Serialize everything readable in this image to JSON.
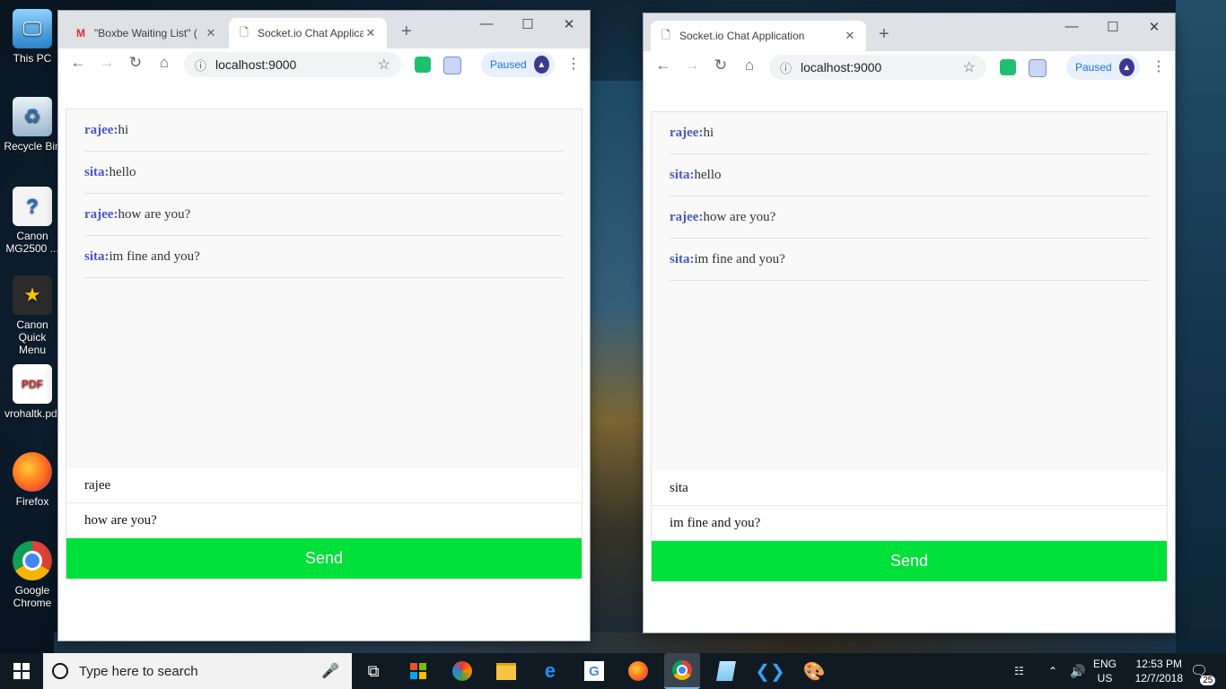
{
  "desktop": {
    "icons": [
      {
        "label_line1": "This PC",
        "label_line2": "",
        "icon": "computer-icon"
      },
      {
        "label_line1": "Recycle Bin",
        "label_line2": "",
        "icon": "recycle-bin-icon"
      },
      {
        "label_line1": "Canon",
        "label_line2": "MG2500 ...",
        "icon": "help-document-icon"
      },
      {
        "label_line1": "Canon Quick",
        "label_line2": "Menu",
        "icon": "canon-menu-icon"
      },
      {
        "label_line1": "vrohaltk.pdf",
        "label_line2": "",
        "icon": "pdf-icon"
      },
      {
        "label_line1": "Firefox",
        "label_line2": "",
        "icon": "firefox-icon"
      },
      {
        "label_line1": "Google",
        "label_line2": "Chrome",
        "icon": "chrome-icon"
      }
    ]
  },
  "window_left": {
    "tabs": [
      {
        "title": "\"Boxbe Waiting List\" (",
        "favicon": "gmail-icon"
      },
      {
        "title": "Socket.io Chat Applica",
        "favicon": "page-icon"
      }
    ],
    "address": "localhost:9000",
    "profile_status": "Paused",
    "messages": [
      {
        "user": "rajee:",
        "text": "hi"
      },
      {
        "user": "sita:",
        "text": "hello"
      },
      {
        "user": "rajee:",
        "text": "how are you?"
      },
      {
        "user": "sita:",
        "text": "im fine and you?"
      }
    ],
    "username_value": "rajee",
    "message_value": "how are you?",
    "send_label": "Send"
  },
  "window_right": {
    "tabs": [
      {
        "title": "Socket.io Chat Application",
        "favicon": "page-icon"
      }
    ],
    "address": "localhost:9000",
    "profile_status": "Paused",
    "messages": [
      {
        "user": "rajee:",
        "text": "hi"
      },
      {
        "user": "sita:",
        "text": "hello"
      },
      {
        "user": "rajee:",
        "text": "how are you?"
      },
      {
        "user": "sita:",
        "text": "im fine and you?"
      }
    ],
    "username_value": "sita",
    "message_value": "im fine and you?",
    "send_label": "Send"
  },
  "taskbar": {
    "search_placeholder": "Type here to search",
    "apps": [
      "task-view-icon",
      "store-icon",
      "app-icon",
      "file-explorer-icon",
      "edge-icon",
      "google-icon",
      "firefox-icon",
      "chrome-icon",
      "notepad-icon",
      "vscode-icon",
      "paint-icon"
    ],
    "lang_line1": "ENG",
    "lang_line2": "US",
    "time": "12:53 PM",
    "date": "12/7/2018",
    "notification_count": "25"
  },
  "colors": {
    "send_button": "#00e03a",
    "username_text": "#4a56c8",
    "taskbar": "#101a22"
  }
}
